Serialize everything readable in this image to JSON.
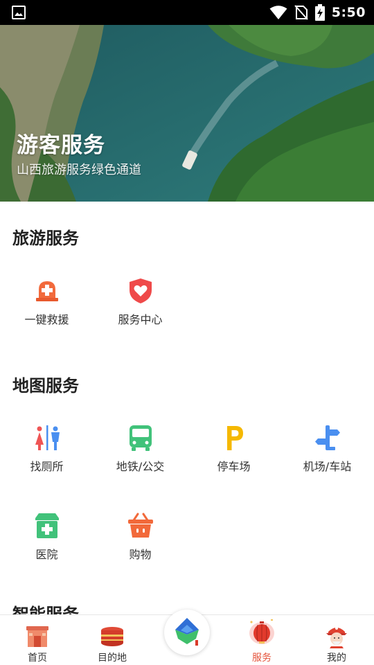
{
  "status_bar": {
    "time": "5:50",
    "icons": [
      "gallery-icon",
      "wifi-icon",
      "no-sim-icon",
      "battery-charging-icon"
    ]
  },
  "hero": {
    "title": "游客服务",
    "subtitle": "山西旅游服务绿色通道"
  },
  "sections": {
    "travel": {
      "title": "旅游服务",
      "items": [
        {
          "label": "一键救援",
          "icon": "rescue-alarm-icon"
        },
        {
          "label": "服务中心",
          "icon": "heart-shield-icon"
        }
      ]
    },
    "map": {
      "title": "地图服务",
      "items": [
        {
          "label": "找厕所",
          "icon": "toilet-icon"
        },
        {
          "label": "地铁/公交",
          "icon": "bus-icon"
        },
        {
          "label": "停车场",
          "icon": "parking-icon"
        },
        {
          "label": "机场/车站",
          "icon": "signpost-icon"
        },
        {
          "label": "医院",
          "icon": "hospital-icon"
        },
        {
          "label": "购物",
          "icon": "shopping-basket-icon"
        }
      ]
    },
    "smart": {
      "title": "智能服务"
    }
  },
  "bottom_nav": {
    "items": [
      {
        "label": "首页",
        "icon": "home-gate-icon"
      },
      {
        "label": "目的地",
        "icon": "drum-icon"
      },
      {
        "label": "",
        "icon": "center-logo-icon"
      },
      {
        "label": "服务",
        "icon": "lantern-icon",
        "active": true
      },
      {
        "label": "我的",
        "icon": "profile-mascot-icon"
      }
    ]
  },
  "colors": {
    "accent": "#e4533b",
    "rescue": "#f26a3c",
    "shield": "#ef4a4a",
    "toilet_female": "#ef5555",
    "toilet_male": "#4a8ff0",
    "bus": "#41c27a",
    "parking": "#f5b800",
    "signpost": "#4a8ff0",
    "hospital": "#41c27a",
    "basket": "#f2693a"
  }
}
